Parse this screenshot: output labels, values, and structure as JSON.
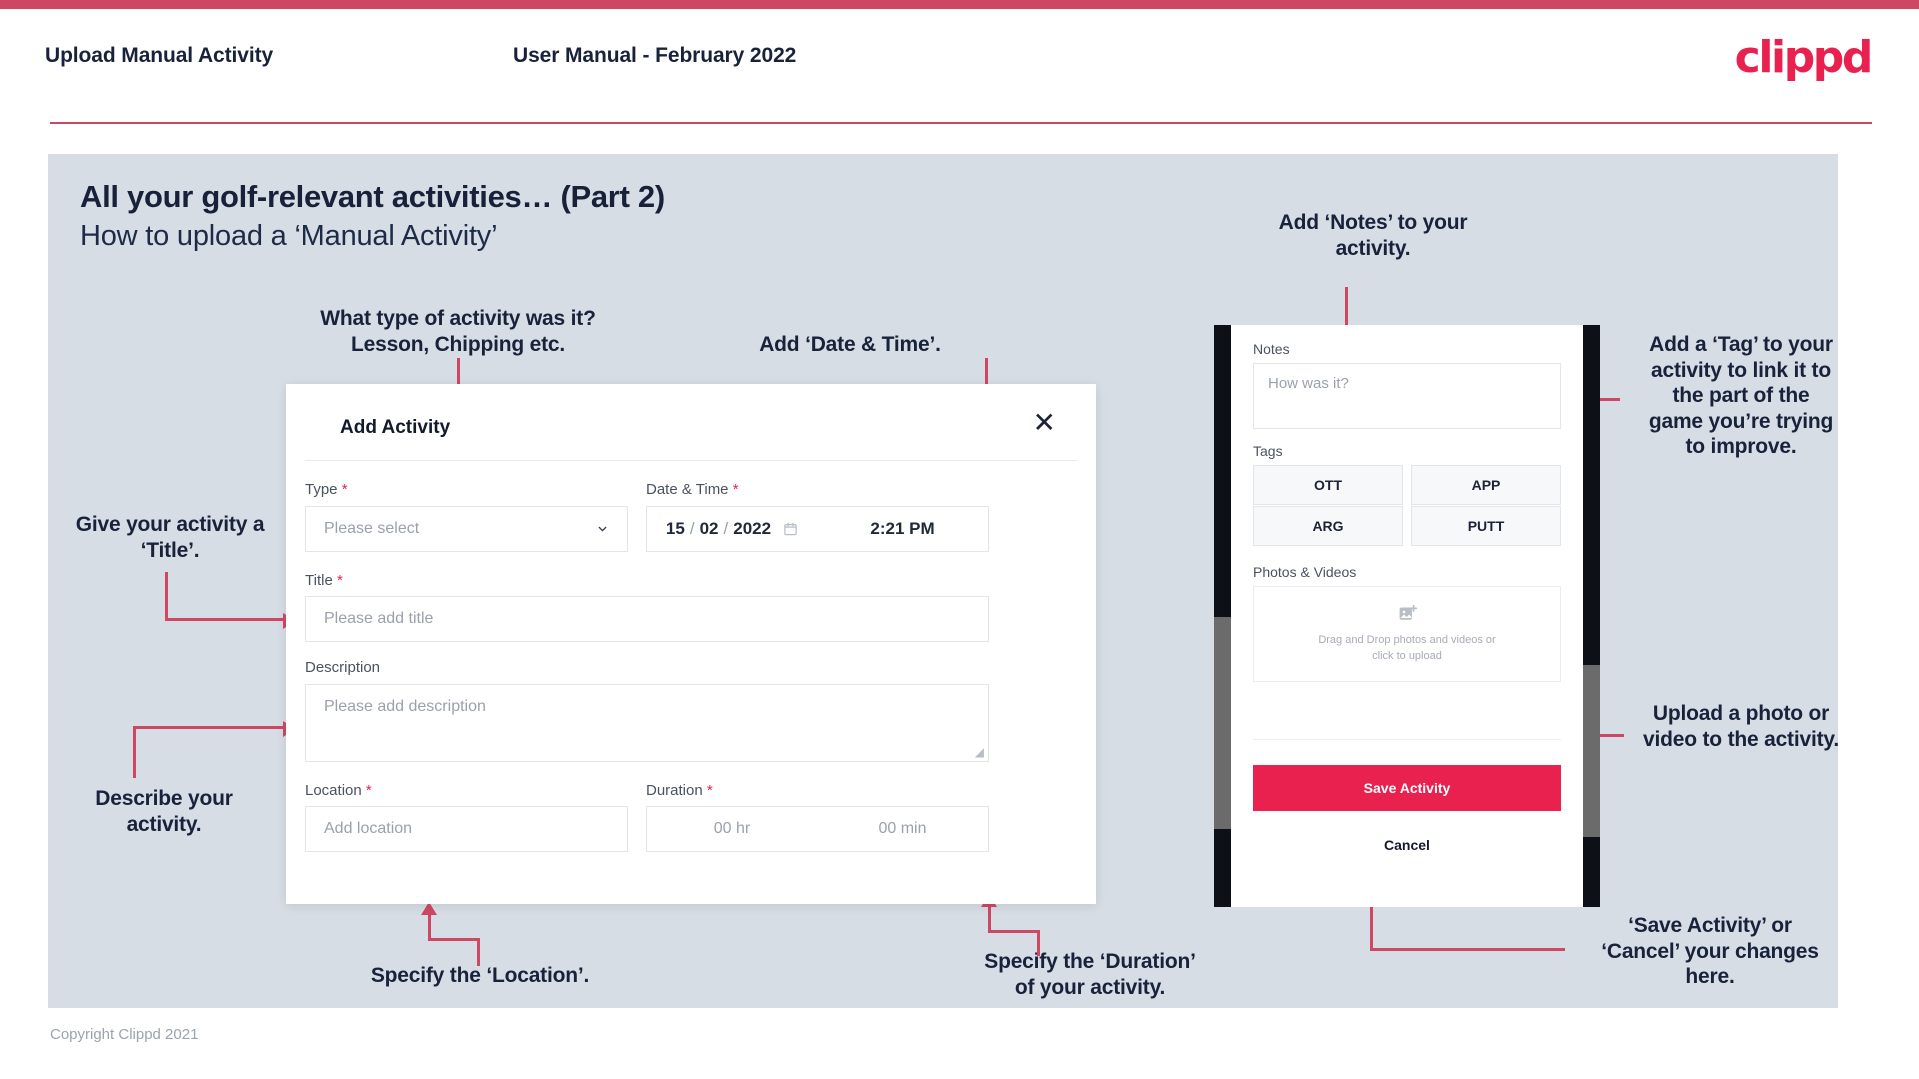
{
  "header": {
    "page_label": "Upload Manual Activity",
    "manual_label": "User Manual - February 2022",
    "logo": "clippd"
  },
  "slide": {
    "title": "All your golf-relevant activities… (Part 2)",
    "subtitle": "How to upload a ‘Manual Activity’"
  },
  "footer": {
    "copyright": "Copyright Clippd 2021"
  },
  "annotations": {
    "type": "What type of activity was it?\nLesson, Chipping etc.",
    "datetime": "Add ‘Date & Time’.",
    "title": "Give your activity a\n‘Title’.",
    "description": "Describe your\nactivity.",
    "location": "Specify the ‘Location’.",
    "duration": "Specify the ‘Duration’\nof your activity.",
    "notes": "Add ‘Notes’ to your\nactivity.",
    "tags": "Add a ‘Tag’ to your\nactivity to link it to\nthe part of the\ngame you’re trying\nto improve.",
    "upload": "Upload a photo or\nvideo to the activity.",
    "save": "‘Save Activity’ or\n‘Cancel’ your changes\nhere."
  },
  "dialog": {
    "title": "Add Activity",
    "close_icon": "close-icon",
    "fields": {
      "type": {
        "label": "Type",
        "required": "*",
        "placeholder": "Please select",
        "chevron": "chevron-down-icon"
      },
      "datetime": {
        "label": "Date & Time",
        "required": "*",
        "day": "15",
        "month": "02",
        "year": "2022",
        "sep": "/",
        "calendar_icon": "calendar-icon",
        "time": "2:21 PM"
      },
      "title": {
        "label": "Title",
        "required": "*",
        "placeholder": "Please add title"
      },
      "description": {
        "label": "Description",
        "required": "",
        "placeholder": "Please add description"
      },
      "location": {
        "label": "Location",
        "required": "*",
        "placeholder": "Add location"
      },
      "duration": {
        "label": "Duration",
        "required": "*",
        "hours_placeholder": "00 hr",
        "minutes_placeholder": "00 min"
      }
    }
  },
  "phone": {
    "notes": {
      "label": "Notes",
      "placeholder": "How was it?"
    },
    "tags": {
      "label": "Tags",
      "items": [
        "OTT",
        "APP",
        "ARG",
        "PUTT"
      ]
    },
    "photos": {
      "label": "Photos & Videos",
      "icon": "add-image-icon",
      "drop_text_line1": "Drag and Drop photos and videos or",
      "drop_text_line2": "click to upload"
    },
    "save_label": "Save Activity",
    "cancel_label": "Cancel"
  },
  "colors": {
    "accent": "#e8214f",
    "arrow": "#cf4863",
    "panel": "#d7dde5",
    "ink": "#18233b"
  }
}
